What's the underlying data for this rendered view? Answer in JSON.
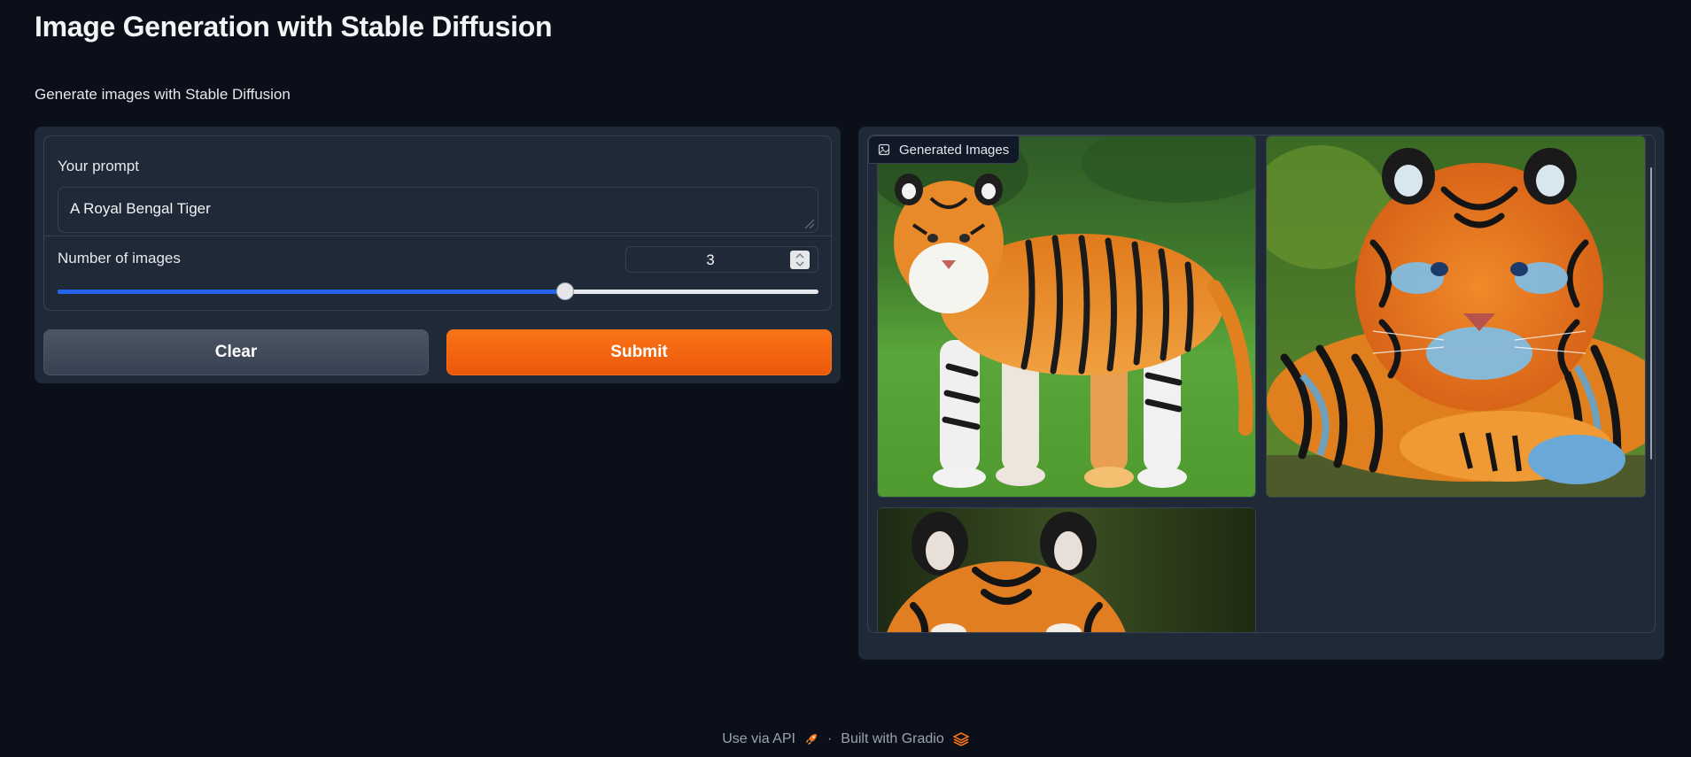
{
  "page": {
    "title": "Image Generation with Stable Diffusion",
    "description": "Generate images with Stable Diffusion"
  },
  "form": {
    "prompt_label": "Your prompt",
    "prompt_value": "A Royal Bengal Tiger",
    "num_images_label": "Number of images",
    "num_images_value": "3",
    "slider": {
      "min": 1,
      "max": 4,
      "value": 3
    }
  },
  "buttons": {
    "clear_label": "Clear",
    "submit_label": "Submit"
  },
  "gallery": {
    "label": "Generated Images",
    "images": [
      {
        "icon": "tiger-standing-image"
      },
      {
        "icon": "tiger-lying-image"
      },
      {
        "icon": "tiger-face-image"
      }
    ]
  },
  "footer": {
    "api_label": "Use via API",
    "separator": "·",
    "built_label": "Built with Gradio"
  },
  "colors": {
    "background": "#0b0f19",
    "panel": "#1f2937",
    "accent": "#f97316",
    "slider": "#2563eb"
  }
}
